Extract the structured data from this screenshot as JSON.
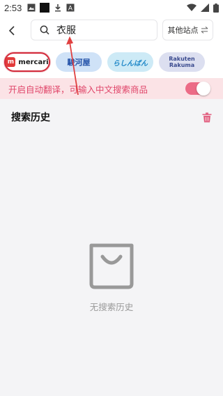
{
  "status_bar": {
    "time": "2:53",
    "left_icons": [
      "image-icon",
      "square-icon",
      "download-icon",
      "a-box-icon"
    ],
    "right_icons": [
      "wifi-icon",
      "signal-icon",
      "battery-icon"
    ]
  },
  "header": {
    "back_icon": "chevron-left-icon",
    "search_icon": "search-icon",
    "search_value": "衣服",
    "other_sites_label": "其他站点",
    "swap_icon": "swap-icon"
  },
  "sites": [
    {
      "id": "mercari",
      "label": "mercari",
      "mark": "m"
    },
    {
      "id": "surugaya",
      "label": "駿河屋"
    },
    {
      "id": "rashinban",
      "label": "らしんばん"
    },
    {
      "id": "rakuma",
      "label_line1": "Rakuten",
      "label_line2": "Rakuma"
    }
  ],
  "translate_bar": {
    "text": "开启自动翻译，可输入中文搜索商品",
    "toggle_on": true
  },
  "history": {
    "title": "搜索历史",
    "trash_icon": "trash-icon",
    "empty_icon": "shopping-bag-icon",
    "empty_text": "无搜索历史"
  },
  "colors": {
    "accent": "#e0466a",
    "toggle": "#ec6b86",
    "translate_bg": "#fbe3e6",
    "background": "#f4f4f6",
    "mercari_border": "#d32c3c"
  }
}
